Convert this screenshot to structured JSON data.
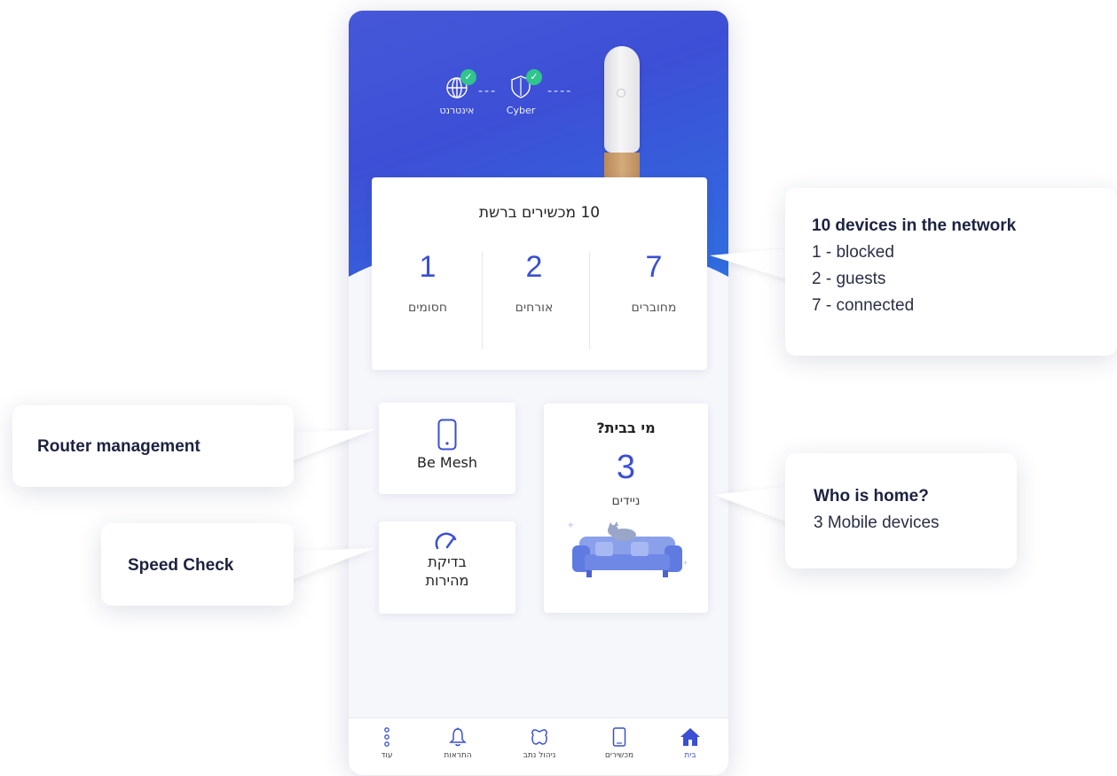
{
  "hero": {
    "nodes": [
      {
        "icon": "globe-icon",
        "label": "אינטרנט",
        "status": "ok"
      },
      {
        "icon": "shield-icon",
        "label": "Cyber",
        "status": "ok"
      }
    ],
    "router_image": "router-device"
  },
  "devices_card": {
    "title": "10 מכשירים ברשת",
    "stats": [
      {
        "value": "7",
        "label": "מחוברים"
      },
      {
        "value": "2",
        "label": "אורחים"
      },
      {
        "value": "1",
        "label": "חסומים"
      }
    ]
  },
  "tiles": {
    "mesh": {
      "icon": "phone-icon",
      "label": "Be Mesh"
    },
    "speed": {
      "icon": "speedometer-icon",
      "label_line1": "בדיקת",
      "label_line2": "מהירות"
    },
    "who_home": {
      "title": "מי בבית?",
      "count": "3",
      "subtitle": "ניידים",
      "illustration": "couch-with-cat"
    }
  },
  "tabbar": {
    "items": [
      {
        "id": "home",
        "icon": "home-icon",
        "label": "בית",
        "active": true
      },
      {
        "id": "devices",
        "icon": "phone-icon",
        "label": "מכשירים",
        "active": false
      },
      {
        "id": "router",
        "icon": "router-icon",
        "label": "ניהול נתב",
        "active": false
      },
      {
        "id": "alerts",
        "icon": "bell-icon",
        "label": "התראות",
        "active": false
      },
      {
        "id": "more",
        "icon": "more-dots-icon",
        "label": "עוד",
        "active": false
      }
    ]
  },
  "callouts": {
    "network": {
      "title": "10 devices in the network",
      "lines": [
        "1 - blocked",
        "2 - guests",
        "7 - connected"
      ]
    },
    "router": {
      "title": "Router management"
    },
    "speed": {
      "title": "Speed Check"
    },
    "home": {
      "title": "Who is home?",
      "lines": [
        "3 Mobile devices"
      ]
    }
  },
  "colors": {
    "accent": "#3a4fd4",
    "hero_start": "#4658d8",
    "hero_end": "#2f6ee0",
    "check": "#31c48d"
  }
}
